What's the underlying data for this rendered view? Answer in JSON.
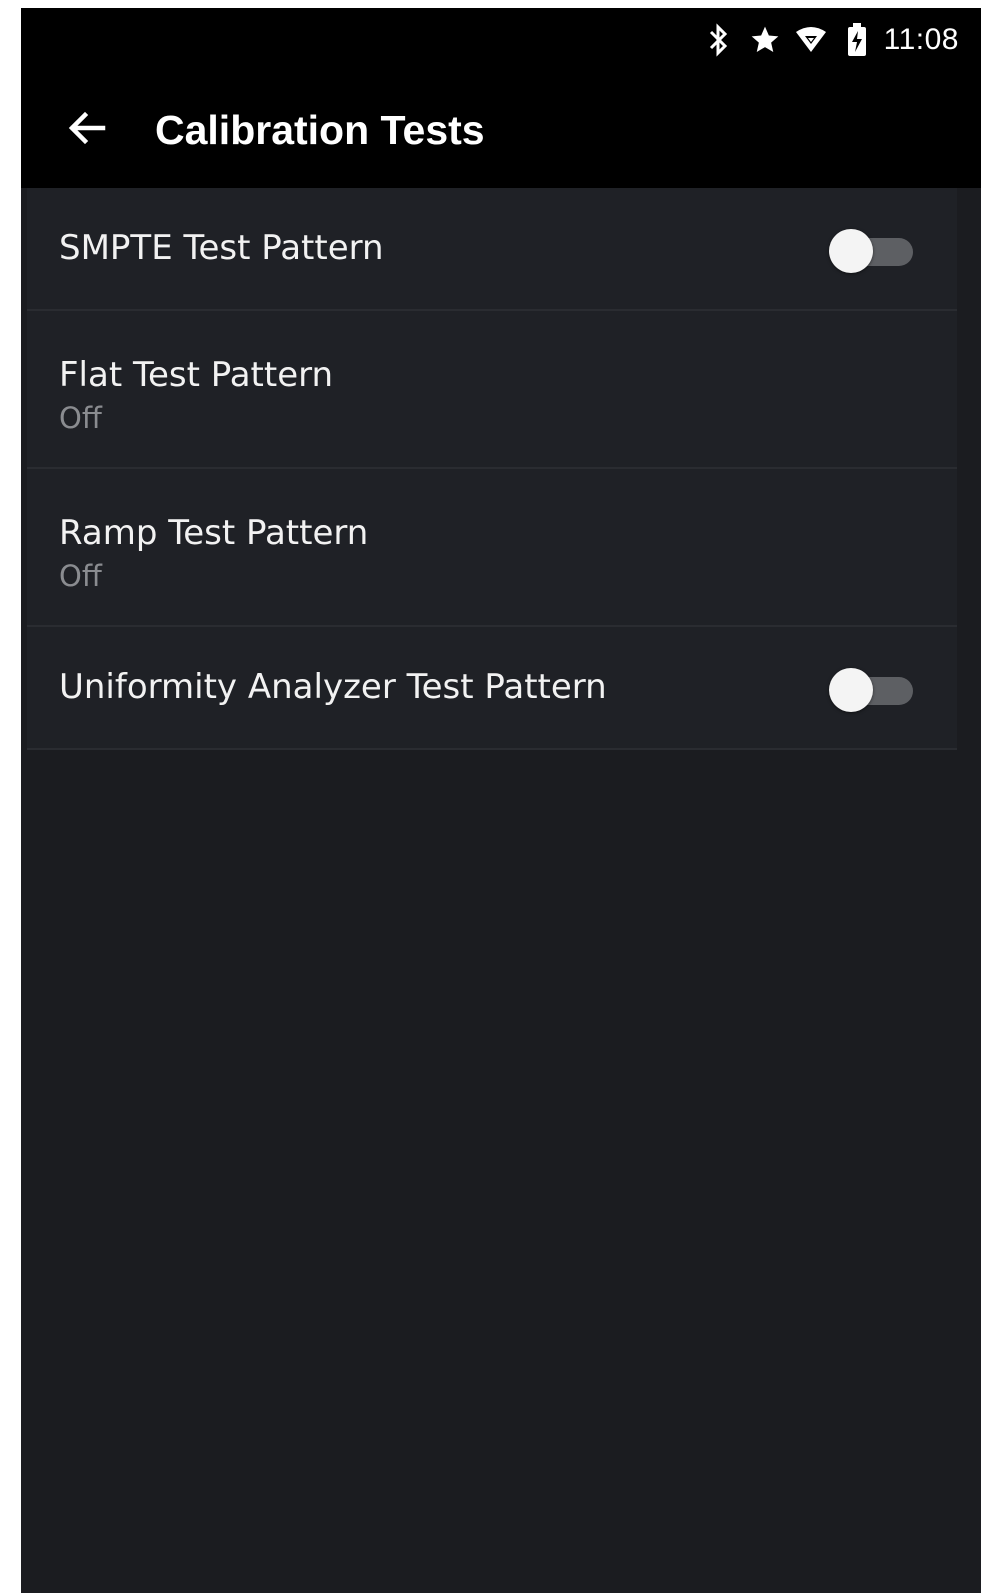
{
  "status_bar": {
    "time": "11:08",
    "icons": [
      "bluetooth-icon",
      "star-icon",
      "wifi-icon",
      "battery-charging-icon"
    ]
  },
  "app_bar": {
    "title": "Calibration Tests",
    "back_icon": "arrow-left-icon"
  },
  "items": [
    {
      "title": "SMPTE Test Pattern",
      "control": "toggle",
      "enabled": false
    },
    {
      "title": "Flat Test Pattern",
      "subtitle": "Off"
    },
    {
      "title": "Ramp Test Pattern",
      "subtitle": "Off"
    },
    {
      "title": "Uniformity Analyzer Test Pattern",
      "control": "toggle",
      "enabled": false
    }
  ],
  "colors": {
    "background": "#1b1c20",
    "app_bar": "#000000",
    "row": "#1f2126",
    "divider": "#2a2c31",
    "subtitle_text": "#8a8c90"
  }
}
